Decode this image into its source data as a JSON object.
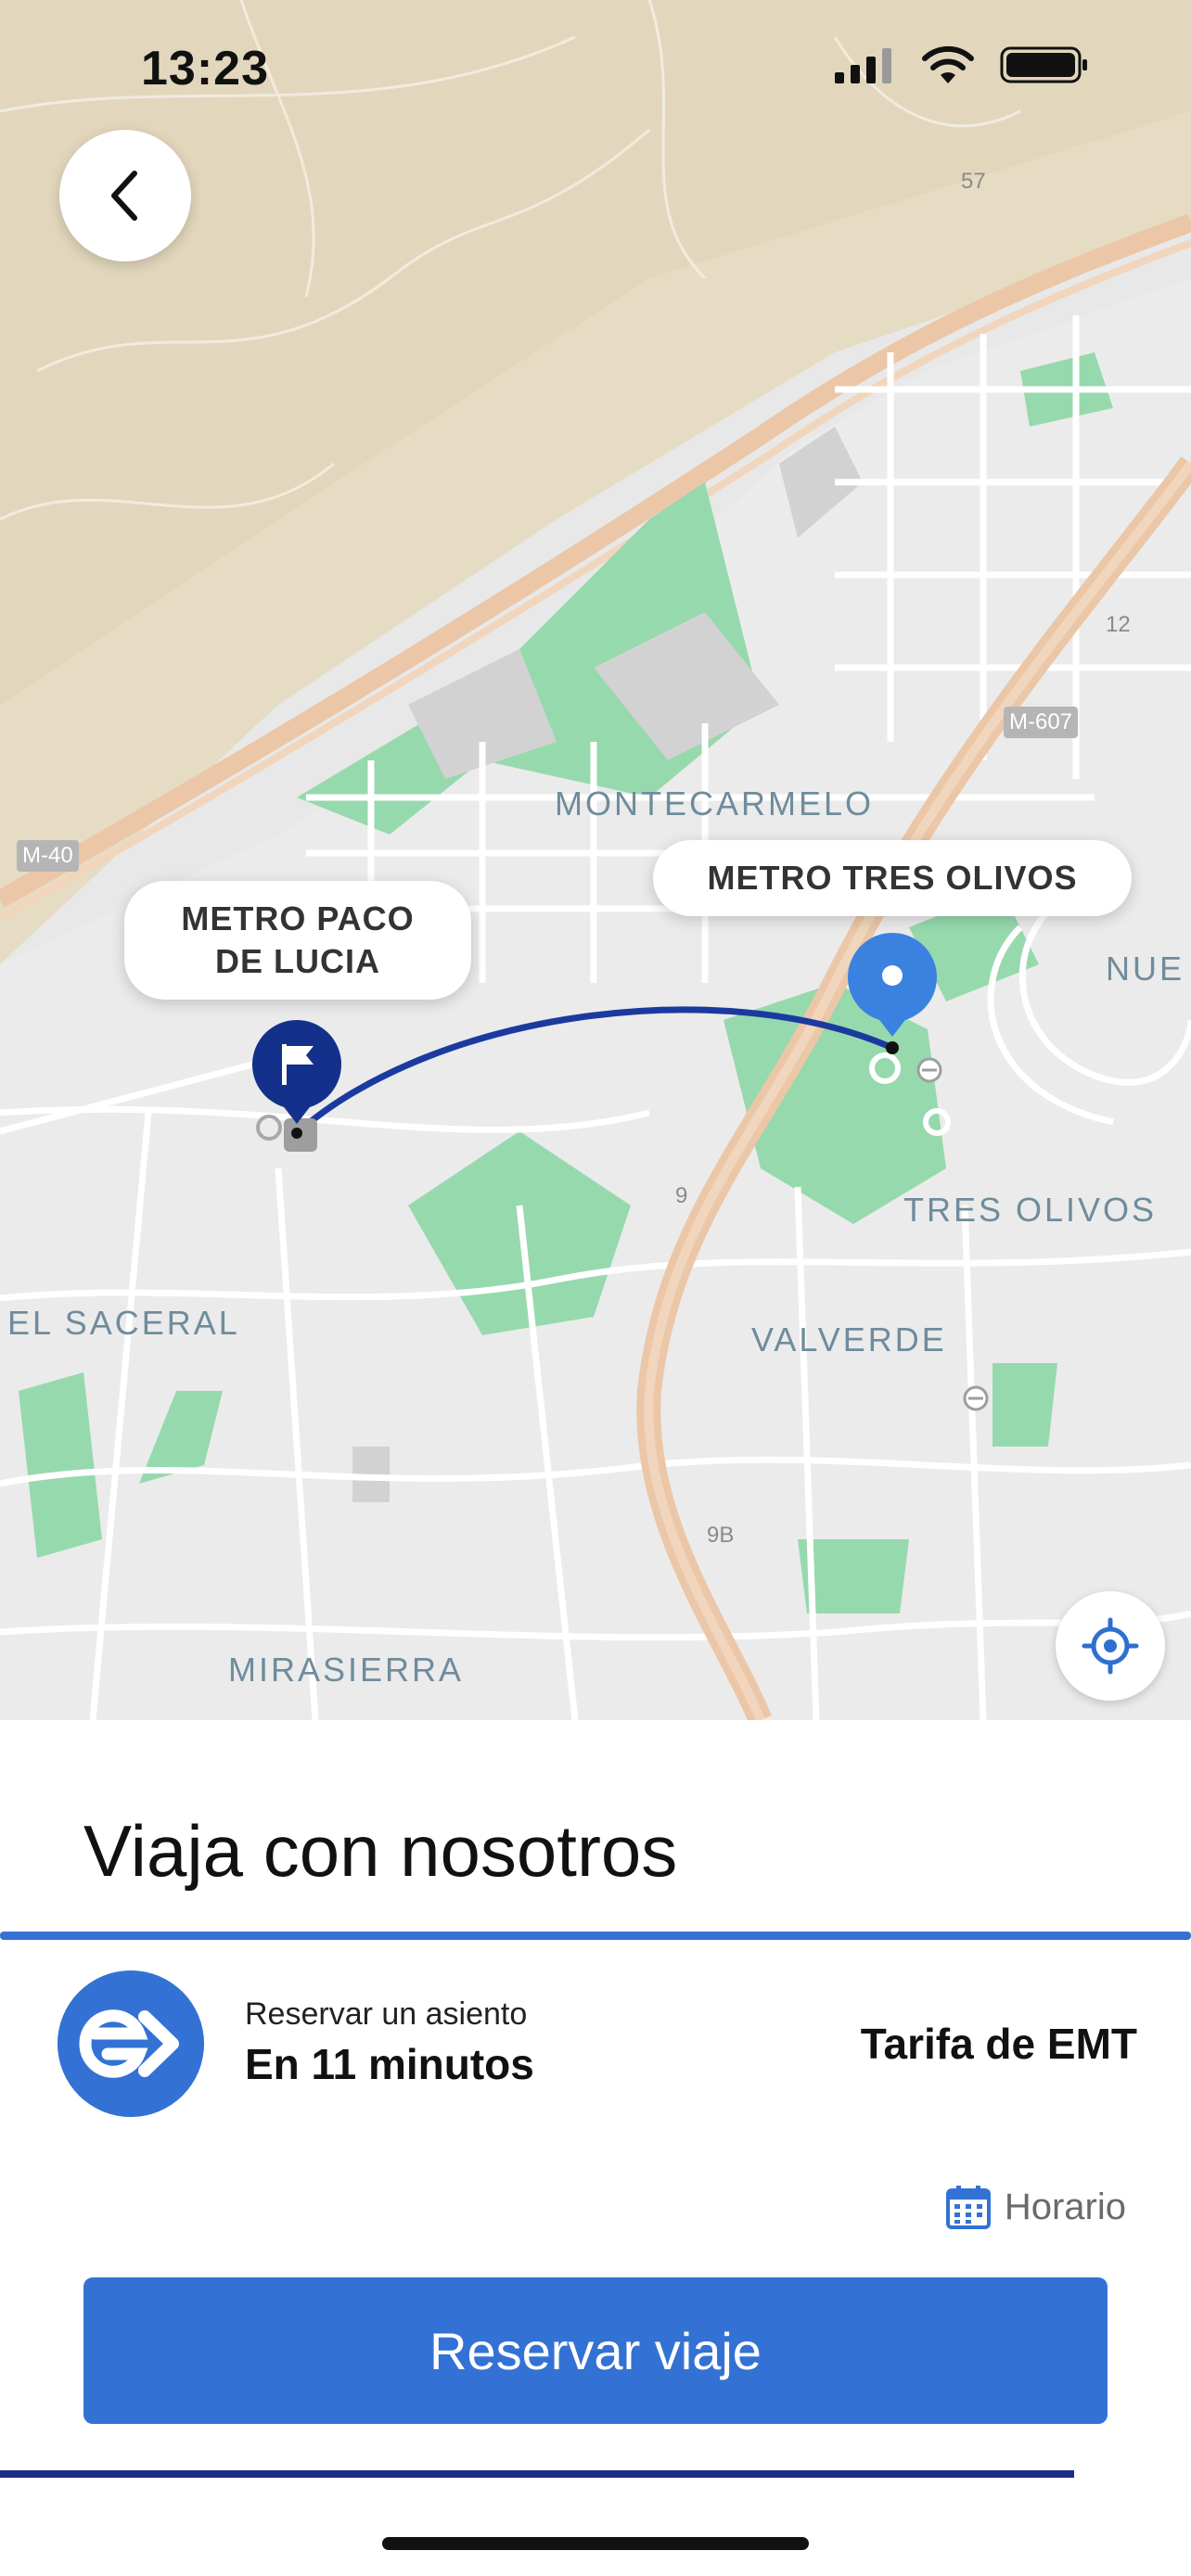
{
  "status_bar": {
    "time": "13:23"
  },
  "map": {
    "areas": {
      "montecarmelo": "MONTECARMELO",
      "tres_olivos": "TRES OLIVOS",
      "el_saceral": "EL SACERAL",
      "valverde": "VALVERDE",
      "mirasierra": "MIRASIERRA",
      "nue": "NUE"
    },
    "roads": {
      "m40": "M-40",
      "m607": "M-607",
      "r57": "57",
      "r12": "12",
      "r9": "9",
      "r9b": "9B"
    },
    "origin_label": "METRO PACO\nDE LUCIA",
    "destination_label": "METRO TRES OLIVOS",
    "route_color": "#1b3aa0",
    "origin_pin_color": "#13318a",
    "destination_pin_color": "#3b82e0"
  },
  "sheet": {
    "title": "Viaja con nosotros",
    "reserve_label": "Reservar un asiento",
    "reserve_time": "En 11 minutos",
    "fare": "Tarifa de EMT",
    "schedule_link": "Horario",
    "cta_label": "Reservar viaje",
    "accent_color": "#3372d4"
  }
}
